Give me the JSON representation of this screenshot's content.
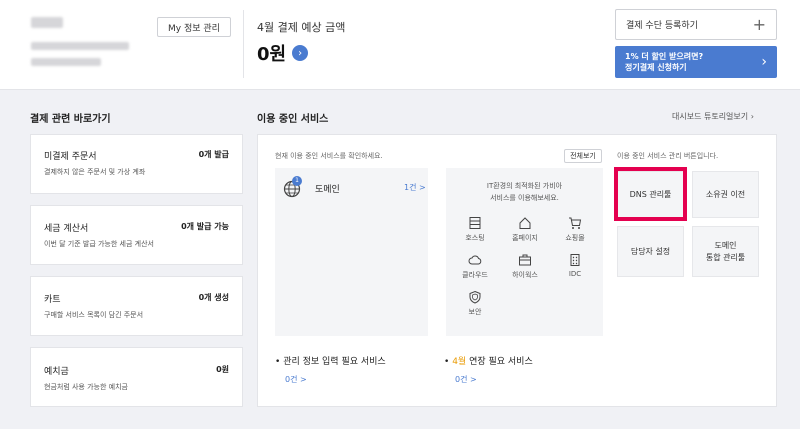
{
  "header": {
    "my_info_btn": "My 정보 관리",
    "expected_label": "4월 결제 예상 금액",
    "expected_amount": "0원",
    "register_payment": "결제 수단 등록하기",
    "promo_line1": "1% 더 할인 받으려면?",
    "promo_line2": "정기결제 신청하기"
  },
  "shortcuts": {
    "title": "결제 관련 바로가기",
    "items": [
      {
        "title": "미결제 주문서",
        "value": "0개 발급",
        "desc": "결제하지 않은 주문서 및 가상 계좌"
      },
      {
        "title": "세금 계산서",
        "value": "0개 발급 가능",
        "desc": "이번 달 기준 발급 가능한 세금 계산서"
      },
      {
        "title": "카트",
        "value": "0개 생성",
        "desc": "구매할 서비스 목록이 담긴 주문서"
      },
      {
        "title": "예치금",
        "value": "0원",
        "desc": "현금처럼 사용 가능한 예치금"
      }
    ]
  },
  "services": {
    "title": "이용 중인 서비스",
    "tutorial": "대시보드 튜토리얼보기",
    "check_text": "현재 이용 중인 서비스를 확인하세요.",
    "view_all": "전체보기",
    "domain_badge": "1",
    "domain_label": "도메인",
    "domain_count": "1건 >",
    "promo_line1": "IT환경의 최적화된 가비아",
    "promo_line2": "서비스를 이용해보세요.",
    "icons": [
      "호스팅",
      "홈페이지",
      "쇼핑몰",
      "클라우드",
      "하이웍스",
      "IDC",
      "보안"
    ],
    "manage_text": "이용 중인 서비스 관리 버튼입니다.",
    "btn_dns": "DNS 관리툴",
    "btn_ownership": "소유권 이전",
    "btn_manager": "담당자 설정",
    "btn_domain_line1": "도메인",
    "btn_domain_line2": "통합 관리툴",
    "bottom1": "관리 정보 입력 필요 서비스",
    "bottom1_count": "0건 >",
    "bottom2_month": "4월",
    "bottom2_rest": " 연장 필요 서비스",
    "bottom2_count": "0건 >"
  },
  "colors": {
    "accent": "#4a7bd0",
    "highlight": "#e4004f",
    "orange": "#e99a00"
  }
}
